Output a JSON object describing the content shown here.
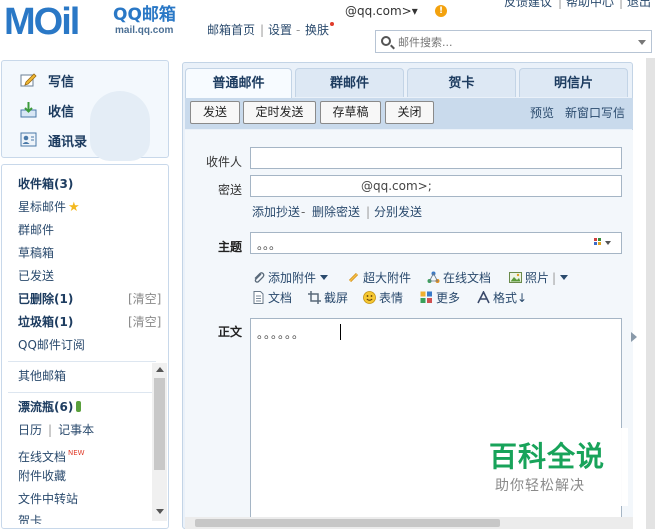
{
  "header": {
    "logo_text": "MOil",
    "brand": "QQ邮箱",
    "site": "mail.qq.com",
    "nav_home": "邮箱首页",
    "nav_settings": "设置",
    "nav_skin": "换肤",
    "account": "@qq.com>▾",
    "top_links": [
      "反馈建议",
      "帮助中心",
      "退出"
    ],
    "search_placeholder": "邮件搜索..."
  },
  "left_top": {
    "write": "写信",
    "inbox": "收信",
    "contacts": "通讯录"
  },
  "folders": {
    "inbox": "收件箱(3)",
    "starred": "星标邮件",
    "group": "群邮件",
    "drafts": "草稿箱",
    "sent": "已发送",
    "deleted": "已删除(1)",
    "spam": "垃圾箱(1)",
    "clear": "[清空]",
    "subscriptions": "QQ邮件订阅",
    "other_mailbox": "其他邮箱",
    "drift_bottle": "漂流瓶(6)",
    "calendar": "日历",
    "notebook": "记事本",
    "online_docs": "在线文档",
    "new_badge": "NEW",
    "attachments": "附件收藏",
    "file_transfer": "文件中转站",
    "greeting_card": "贺卡"
  },
  "tabs": [
    "普通邮件",
    "群邮件",
    "贺卡",
    "明信片"
  ],
  "toolbar": {
    "send": "发送",
    "scheduled_send": "定时发送",
    "save_draft": "存草稿",
    "close": "关闭",
    "preview": "预览",
    "new_window": "新窗口写信"
  },
  "form": {
    "to_label": "收件人",
    "to_value": "",
    "cc_label": "密送",
    "cc_value": "@qq.com>;",
    "add_cc": "添加抄送",
    "remove_bcc": "删除密送",
    "separate_send": "分别发送",
    "subject_label": "主题",
    "subject_value": "。。。",
    "body_label": "正文",
    "body_value": "。。。。。。"
  },
  "attachments_bar": {
    "add_attachment": "添加附件",
    "large_attachment": "超大附件",
    "online_doc": "在线文档",
    "photo": "照片",
    "document": "文档",
    "screenshot": "截屏",
    "emoticon": "表情",
    "more": "更多",
    "format": "格式↓"
  },
  "watermark": {
    "title": "百科全说",
    "subtitle": "助你轻松解决"
  },
  "colors": {
    "brand": "#2a78c6",
    "link": "#2a4a6d",
    "pane_bg": "#eaf1f9",
    "watermark_green": "#18a35a"
  }
}
